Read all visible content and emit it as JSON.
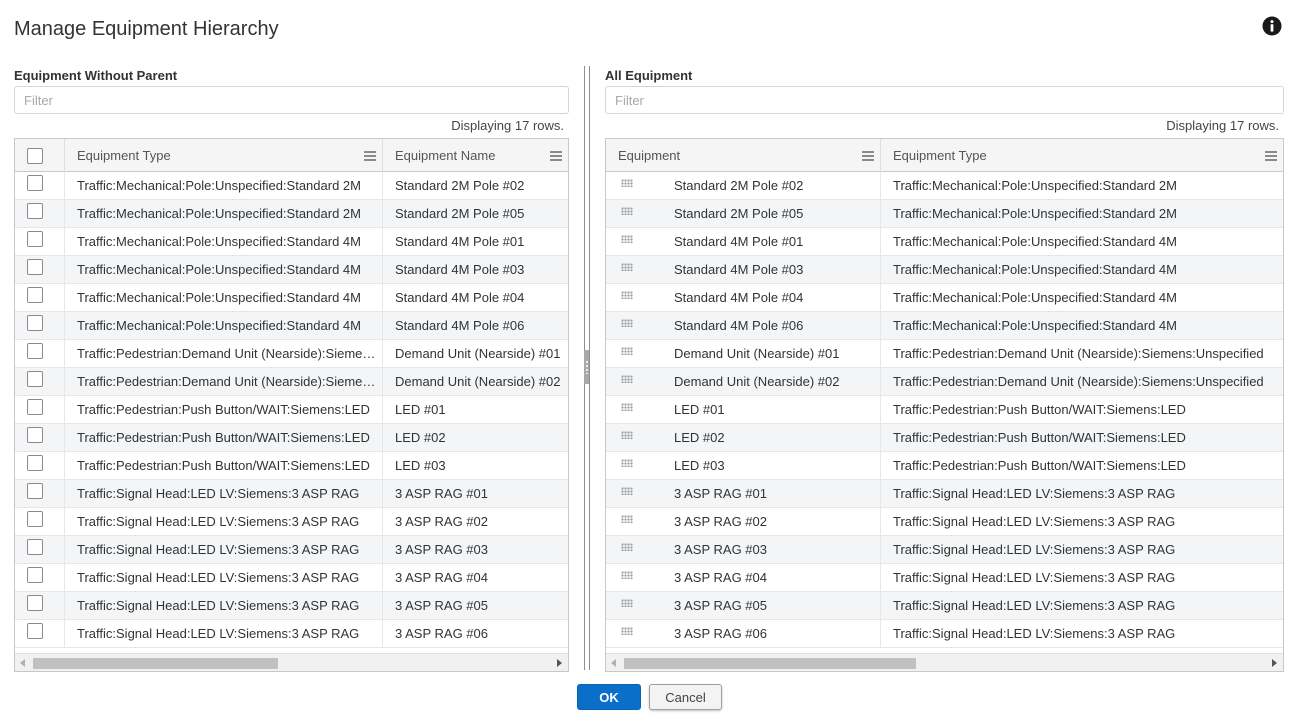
{
  "dialog": {
    "title": "Manage Equipment Hierarchy",
    "info_icon": "info-circle-icon",
    "ok_label": "OK",
    "cancel_label": "Cancel",
    "primary_color": "#0a6fc9"
  },
  "left_panel": {
    "label": "Equipment Without Parent",
    "filter_placeholder": "Filter",
    "row_count": "Displaying 17 rows.",
    "columns": [
      "Equipment Type",
      "Equipment Name"
    ],
    "rows": [
      {
        "type": "Traffic:Mechanical:Pole:Unspecified:Standard 2M",
        "name": "Standard 2M Pole #02"
      },
      {
        "type": "Traffic:Mechanical:Pole:Unspecified:Standard 2M",
        "name": "Standard 2M Pole #05"
      },
      {
        "type": "Traffic:Mechanical:Pole:Unspecified:Standard 4M",
        "name": "Standard 4M Pole #01"
      },
      {
        "type": "Traffic:Mechanical:Pole:Unspecified:Standard 4M",
        "name": "Standard 4M Pole #03"
      },
      {
        "type": "Traffic:Mechanical:Pole:Unspecified:Standard 4M",
        "name": "Standard 4M Pole #04"
      },
      {
        "type": "Traffic:Mechanical:Pole:Unspecified:Standard 4M",
        "name": "Standard 4M Pole #06"
      },
      {
        "type": "Traffic:Pedestrian:Demand Unit (Nearside):Siemens:Unspecified",
        "name": "Demand Unit (Nearside) #01"
      },
      {
        "type": "Traffic:Pedestrian:Demand Unit (Nearside):Siemens:Unspecified",
        "name": "Demand Unit (Nearside) #02"
      },
      {
        "type": "Traffic:Pedestrian:Push Button/WAIT:Siemens:LED",
        "name": "LED #01"
      },
      {
        "type": "Traffic:Pedestrian:Push Button/WAIT:Siemens:LED",
        "name": "LED #02"
      },
      {
        "type": "Traffic:Pedestrian:Push Button/WAIT:Siemens:LED",
        "name": "LED #03"
      },
      {
        "type": "Traffic:Signal Head:LED LV:Siemens:3 ASP RAG",
        "name": "3 ASP RAG #01"
      },
      {
        "type": "Traffic:Signal Head:LED LV:Siemens:3 ASP RAG",
        "name": "3 ASP RAG #02"
      },
      {
        "type": "Traffic:Signal Head:LED LV:Siemens:3 ASP RAG",
        "name": "3 ASP RAG #03"
      },
      {
        "type": "Traffic:Signal Head:LED LV:Siemens:3 ASP RAG",
        "name": "3 ASP RAG #04"
      },
      {
        "type": "Traffic:Signal Head:LED LV:Siemens:3 ASP RAG",
        "name": "3 ASP RAG #05"
      },
      {
        "type": "Traffic:Signal Head:LED LV:Siemens:3 ASP RAG",
        "name": "3 ASP RAG #06"
      }
    ]
  },
  "right_panel": {
    "label": "All Equipment",
    "filter_placeholder": "Filter",
    "row_count": "Displaying 17 rows.",
    "columns": [
      "Equipment",
      "Equipment Type"
    ],
    "rows": [
      {
        "name": "Standard 2M Pole #02",
        "type": "Traffic:Mechanical:Pole:Unspecified:Standard 2M"
      },
      {
        "name": "Standard 2M Pole #05",
        "type": "Traffic:Mechanical:Pole:Unspecified:Standard 2M"
      },
      {
        "name": "Standard 4M Pole #01",
        "type": "Traffic:Mechanical:Pole:Unspecified:Standard 4M"
      },
      {
        "name": "Standard 4M Pole #03",
        "type": "Traffic:Mechanical:Pole:Unspecified:Standard 4M"
      },
      {
        "name": "Standard 4M Pole #04",
        "type": "Traffic:Mechanical:Pole:Unspecified:Standard 4M"
      },
      {
        "name": "Standard 4M Pole #06",
        "type": "Traffic:Mechanical:Pole:Unspecified:Standard 4M"
      },
      {
        "name": "Demand Unit (Nearside) #01",
        "type": "Traffic:Pedestrian:Demand Unit (Nearside):Siemens:Unspecified"
      },
      {
        "name": "Demand Unit (Nearside) #02",
        "type": "Traffic:Pedestrian:Demand Unit (Nearside):Siemens:Unspecified"
      },
      {
        "name": "LED #01",
        "type": "Traffic:Pedestrian:Push Button/WAIT:Siemens:LED"
      },
      {
        "name": "LED #02",
        "type": "Traffic:Pedestrian:Push Button/WAIT:Siemens:LED"
      },
      {
        "name": "LED #03",
        "type": "Traffic:Pedestrian:Push Button/WAIT:Siemens:LED"
      },
      {
        "name": "3 ASP RAG #01",
        "type": "Traffic:Signal Head:LED LV:Siemens:3 ASP RAG"
      },
      {
        "name": "3 ASP RAG #02",
        "type": "Traffic:Signal Head:LED LV:Siemens:3 ASP RAG"
      },
      {
        "name": "3 ASP RAG #03",
        "type": "Traffic:Signal Head:LED LV:Siemens:3 ASP RAG"
      },
      {
        "name": "3 ASP RAG #04",
        "type": "Traffic:Signal Head:LED LV:Siemens:3 ASP RAG"
      },
      {
        "name": "3 ASP RAG #05",
        "type": "Traffic:Signal Head:LED LV:Siemens:3 ASP RAG"
      },
      {
        "name": "3 ASP RAG #06",
        "type": "Traffic:Signal Head:LED LV:Siemens:3 ASP RAG"
      }
    ]
  }
}
